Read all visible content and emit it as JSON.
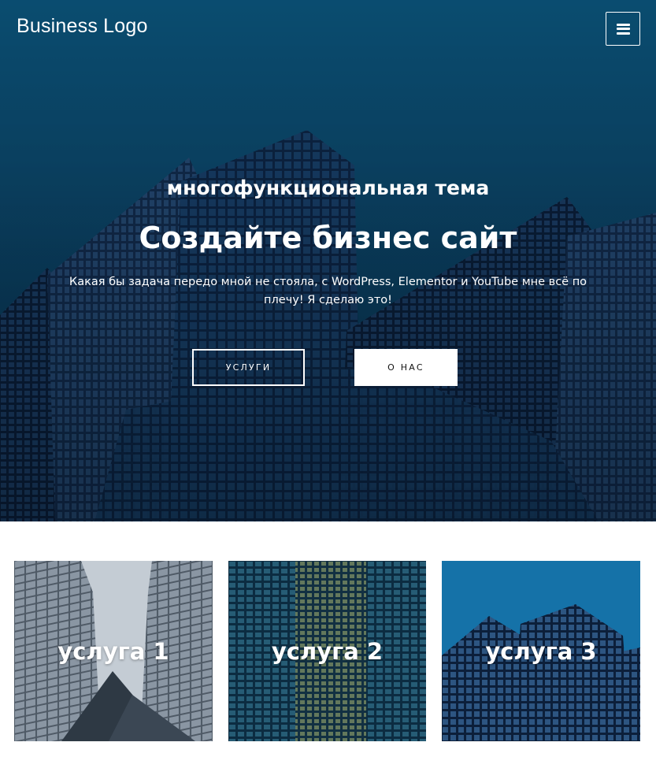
{
  "header": {
    "logo": "Business Logo",
    "menu_icon": "hamburger-menu-icon"
  },
  "hero": {
    "subtitle": "многофункциональная тема",
    "title": "Создайте бизнес сайт",
    "description": "Какая бы задача передо мной не стояла, с WordPress, Elementor и YouTube мне всё по плечу! Я сделаю это!",
    "buttons": {
      "services": "УСЛУГИ",
      "about": "О НАС"
    }
  },
  "services": [
    {
      "label": "услуга 1"
    },
    {
      "label": "услуга 2"
    },
    {
      "label": "услуга 3"
    }
  ],
  "colors": {
    "hero_sky": "#0a5478",
    "building_dark": "#0a1a33",
    "text": "#ffffff"
  }
}
